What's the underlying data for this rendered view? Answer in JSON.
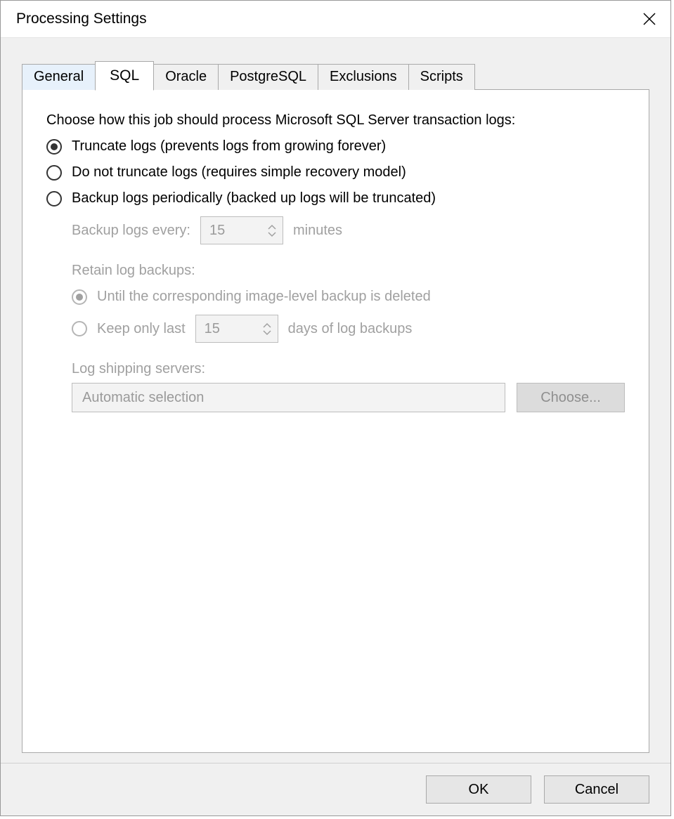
{
  "window": {
    "title": "Processing Settings"
  },
  "tabs": {
    "general": "General",
    "sql": "SQL",
    "oracle": "Oracle",
    "postgresql": "PostgreSQL",
    "exclusions": "Exclusions",
    "scripts": "Scripts",
    "active": "sql"
  },
  "sql": {
    "intro": "Choose how this job should process Microsoft SQL Server transaction logs:",
    "opt_truncate": "Truncate logs (prevents logs from growing forever)",
    "opt_no_truncate": "Do not truncate logs (requires simple recovery model)",
    "opt_backup": "Backup logs periodically (backed up logs will be truncated)",
    "selected": "truncate",
    "backup_every_label": "Backup logs every:",
    "backup_every_value": "15",
    "backup_every_unit": "minutes",
    "retain_heading": "Retain log backups:",
    "retain_until": "Until the corresponding image-level backup is deleted",
    "retain_keep_prefix": "Keep only last",
    "retain_keep_value": "15",
    "retain_keep_suffix": "days of log backups",
    "retain_selected": "until",
    "shipping_label": "Log shipping servers:",
    "shipping_value": "Automatic selection",
    "choose_button": "Choose..."
  },
  "footer": {
    "ok": "OK",
    "cancel": "Cancel"
  }
}
